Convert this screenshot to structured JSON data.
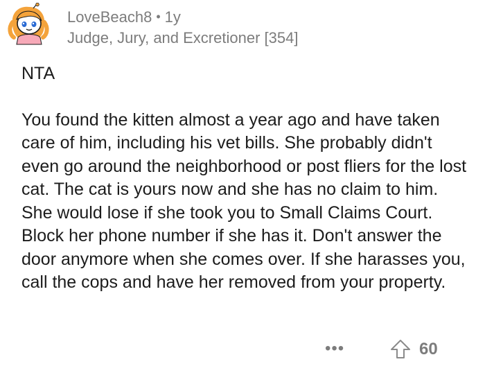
{
  "comment": {
    "username": "LoveBeach8",
    "age": "1y",
    "flair": "Judge, Jury, and Excretioner [354]",
    "verdict": "NTA",
    "body": "You found the kitten almost a year ago and have taken care of him, including his vet bills. She probably didn't even go around the neighborhood or post fliers for the lost cat. The cat is yours now and she has no claim to him. She would lose if she took you to Small Claims Court. Block her phone number if she has it. Don't answer the door anymore when she comes over. If she harasses you, call the cops and have her removed from your property.",
    "more_label": "•••",
    "score": "60"
  },
  "icons": {
    "avatar": "avatar-icon",
    "upvote": "upvote-arrow-icon",
    "more": "more-options-icon"
  },
  "colors": {
    "text": "#1c1c1c",
    "muted": "#7c7c7c",
    "avatar_hair": "#f4a33b",
    "avatar_shirt": "#f7a9b8"
  }
}
